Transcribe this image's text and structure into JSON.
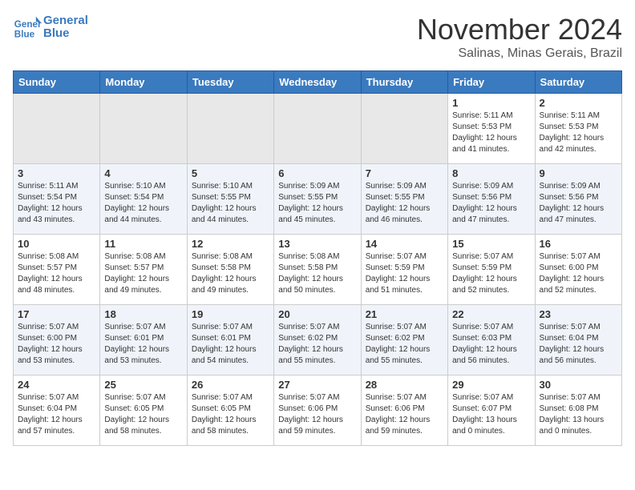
{
  "header": {
    "logo_line1": "General",
    "logo_line2": "Blue",
    "month": "November 2024",
    "location": "Salinas, Minas Gerais, Brazil"
  },
  "days_of_week": [
    "Sunday",
    "Monday",
    "Tuesday",
    "Wednesday",
    "Thursday",
    "Friday",
    "Saturday"
  ],
  "weeks": [
    [
      {
        "day": "",
        "info": ""
      },
      {
        "day": "",
        "info": ""
      },
      {
        "day": "",
        "info": ""
      },
      {
        "day": "",
        "info": ""
      },
      {
        "day": "",
        "info": ""
      },
      {
        "day": "1",
        "info": "Sunrise: 5:11 AM\nSunset: 5:53 PM\nDaylight: 12 hours\nand 41 minutes."
      },
      {
        "day": "2",
        "info": "Sunrise: 5:11 AM\nSunset: 5:53 PM\nDaylight: 12 hours\nand 42 minutes."
      }
    ],
    [
      {
        "day": "3",
        "info": "Sunrise: 5:11 AM\nSunset: 5:54 PM\nDaylight: 12 hours\nand 43 minutes."
      },
      {
        "day": "4",
        "info": "Sunrise: 5:10 AM\nSunset: 5:54 PM\nDaylight: 12 hours\nand 44 minutes."
      },
      {
        "day": "5",
        "info": "Sunrise: 5:10 AM\nSunset: 5:55 PM\nDaylight: 12 hours\nand 44 minutes."
      },
      {
        "day": "6",
        "info": "Sunrise: 5:09 AM\nSunset: 5:55 PM\nDaylight: 12 hours\nand 45 minutes."
      },
      {
        "day": "7",
        "info": "Sunrise: 5:09 AM\nSunset: 5:55 PM\nDaylight: 12 hours\nand 46 minutes."
      },
      {
        "day": "8",
        "info": "Sunrise: 5:09 AM\nSunset: 5:56 PM\nDaylight: 12 hours\nand 47 minutes."
      },
      {
        "day": "9",
        "info": "Sunrise: 5:09 AM\nSunset: 5:56 PM\nDaylight: 12 hours\nand 47 minutes."
      }
    ],
    [
      {
        "day": "10",
        "info": "Sunrise: 5:08 AM\nSunset: 5:57 PM\nDaylight: 12 hours\nand 48 minutes."
      },
      {
        "day": "11",
        "info": "Sunrise: 5:08 AM\nSunset: 5:57 PM\nDaylight: 12 hours\nand 49 minutes."
      },
      {
        "day": "12",
        "info": "Sunrise: 5:08 AM\nSunset: 5:58 PM\nDaylight: 12 hours\nand 49 minutes."
      },
      {
        "day": "13",
        "info": "Sunrise: 5:08 AM\nSunset: 5:58 PM\nDaylight: 12 hours\nand 50 minutes."
      },
      {
        "day": "14",
        "info": "Sunrise: 5:07 AM\nSunset: 5:59 PM\nDaylight: 12 hours\nand 51 minutes."
      },
      {
        "day": "15",
        "info": "Sunrise: 5:07 AM\nSunset: 5:59 PM\nDaylight: 12 hours\nand 52 minutes."
      },
      {
        "day": "16",
        "info": "Sunrise: 5:07 AM\nSunset: 6:00 PM\nDaylight: 12 hours\nand 52 minutes."
      }
    ],
    [
      {
        "day": "17",
        "info": "Sunrise: 5:07 AM\nSunset: 6:00 PM\nDaylight: 12 hours\nand 53 minutes."
      },
      {
        "day": "18",
        "info": "Sunrise: 5:07 AM\nSunset: 6:01 PM\nDaylight: 12 hours\nand 53 minutes."
      },
      {
        "day": "19",
        "info": "Sunrise: 5:07 AM\nSunset: 6:01 PM\nDaylight: 12 hours\nand 54 minutes."
      },
      {
        "day": "20",
        "info": "Sunrise: 5:07 AM\nSunset: 6:02 PM\nDaylight: 12 hours\nand 55 minutes."
      },
      {
        "day": "21",
        "info": "Sunrise: 5:07 AM\nSunset: 6:02 PM\nDaylight: 12 hours\nand 55 minutes."
      },
      {
        "day": "22",
        "info": "Sunrise: 5:07 AM\nSunset: 6:03 PM\nDaylight: 12 hours\nand 56 minutes."
      },
      {
        "day": "23",
        "info": "Sunrise: 5:07 AM\nSunset: 6:04 PM\nDaylight: 12 hours\nand 56 minutes."
      }
    ],
    [
      {
        "day": "24",
        "info": "Sunrise: 5:07 AM\nSunset: 6:04 PM\nDaylight: 12 hours\nand 57 minutes."
      },
      {
        "day": "25",
        "info": "Sunrise: 5:07 AM\nSunset: 6:05 PM\nDaylight: 12 hours\nand 58 minutes."
      },
      {
        "day": "26",
        "info": "Sunrise: 5:07 AM\nSunset: 6:05 PM\nDaylight: 12 hours\nand 58 minutes."
      },
      {
        "day": "27",
        "info": "Sunrise: 5:07 AM\nSunset: 6:06 PM\nDaylight: 12 hours\nand 59 minutes."
      },
      {
        "day": "28",
        "info": "Sunrise: 5:07 AM\nSunset: 6:06 PM\nDaylight: 12 hours\nand 59 minutes."
      },
      {
        "day": "29",
        "info": "Sunrise: 5:07 AM\nSunset: 6:07 PM\nDaylight: 13 hours\nand 0 minutes."
      },
      {
        "day": "30",
        "info": "Sunrise: 5:07 AM\nSunset: 6:08 PM\nDaylight: 13 hours\nand 0 minutes."
      }
    ]
  ]
}
